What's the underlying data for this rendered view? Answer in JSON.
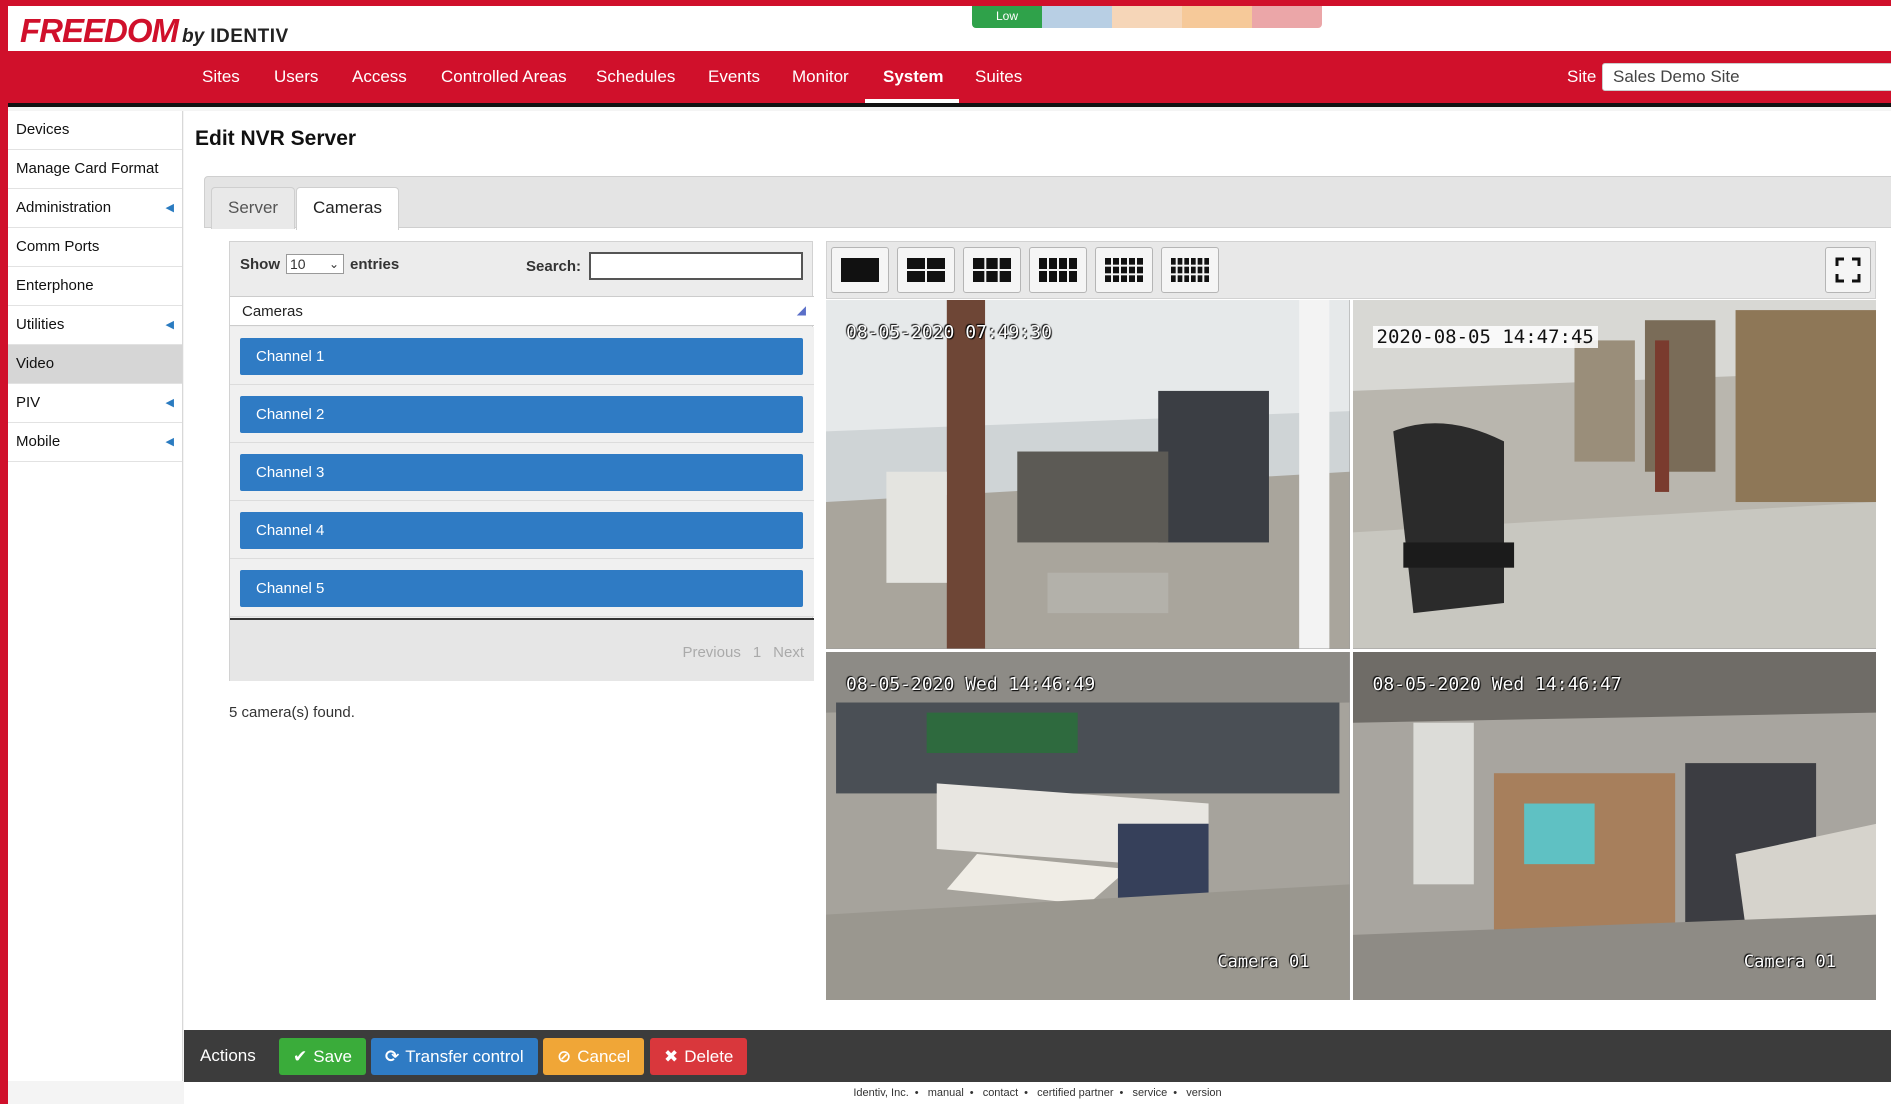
{
  "brand": {
    "name": "FREEDOM",
    "by": "by",
    "maker": "IDENTIV"
  },
  "threat": {
    "levels": [
      {
        "label": "Low",
        "color": "#2fa24a"
      },
      {
        "label": "",
        "color": "#b8cfe4"
      },
      {
        "label": "",
        "color": "#f6d6b8"
      },
      {
        "label": "",
        "color": "#f6c999"
      },
      {
        "label": "",
        "color": "#eba6a8"
      }
    ]
  },
  "nav": {
    "items": [
      "Sites",
      "Users",
      "Access",
      "Controlled Areas",
      "Schedules",
      "Events",
      "Monitor",
      "System",
      "Suites"
    ],
    "active": "System",
    "site_label": "Site",
    "site_value": "Sales Demo Site"
  },
  "sidebar": {
    "items": [
      {
        "label": "Devices",
        "has_sub": false
      },
      {
        "label": "Manage Card Format",
        "has_sub": false
      },
      {
        "label": "Administration",
        "has_sub": true
      },
      {
        "label": "Comm Ports",
        "has_sub": false
      },
      {
        "label": "Enterphone",
        "has_sub": false
      },
      {
        "label": "Utilities",
        "has_sub": true
      },
      {
        "label": "Video",
        "has_sub": false
      },
      {
        "label": "PIV",
        "has_sub": true
      },
      {
        "label": "Mobile",
        "has_sub": true
      }
    ],
    "selected": "Video"
  },
  "page": {
    "title": "Edit NVR Server"
  },
  "tabs": [
    {
      "label": "Server"
    },
    {
      "label": "Cameras"
    }
  ],
  "active_tab": "Cameras",
  "camera_list": {
    "show_label": "Show",
    "page_size": "10",
    "entries_label": "entries",
    "search_label": "Search:",
    "search_value": "",
    "column_header": "Cameras",
    "rows": [
      "Channel 1",
      "Channel 2",
      "Channel 3",
      "Channel 4",
      "Channel 5"
    ],
    "pager": {
      "previous": "Previous",
      "page": "1",
      "next": "Next"
    },
    "found_text": "5 camera(s) found."
  },
  "video": {
    "layouts": [
      "1x1",
      "2x2",
      "3x3",
      "4x4",
      "5x5",
      "6x6"
    ],
    "tiles": [
      {
        "timestamp": "08-05-2020 07:49:30",
        "label": ""
      },
      {
        "timestamp": "2020-08-05 14:47:45",
        "label": ""
      },
      {
        "timestamp": "08-05-2020 Wed 14:46:49",
        "label": "Camera 01"
      },
      {
        "timestamp": "08-05-2020 Wed 14:46:47",
        "label": "Camera 01"
      }
    ]
  },
  "actions": {
    "label": "Actions",
    "save": "Save",
    "transfer": "Transfer control",
    "cancel": "Cancel",
    "delete": "Delete"
  },
  "footer": {
    "links": [
      "Identiv, Inc.",
      "manual",
      "contact",
      "certified partner",
      "service",
      "version"
    ]
  }
}
